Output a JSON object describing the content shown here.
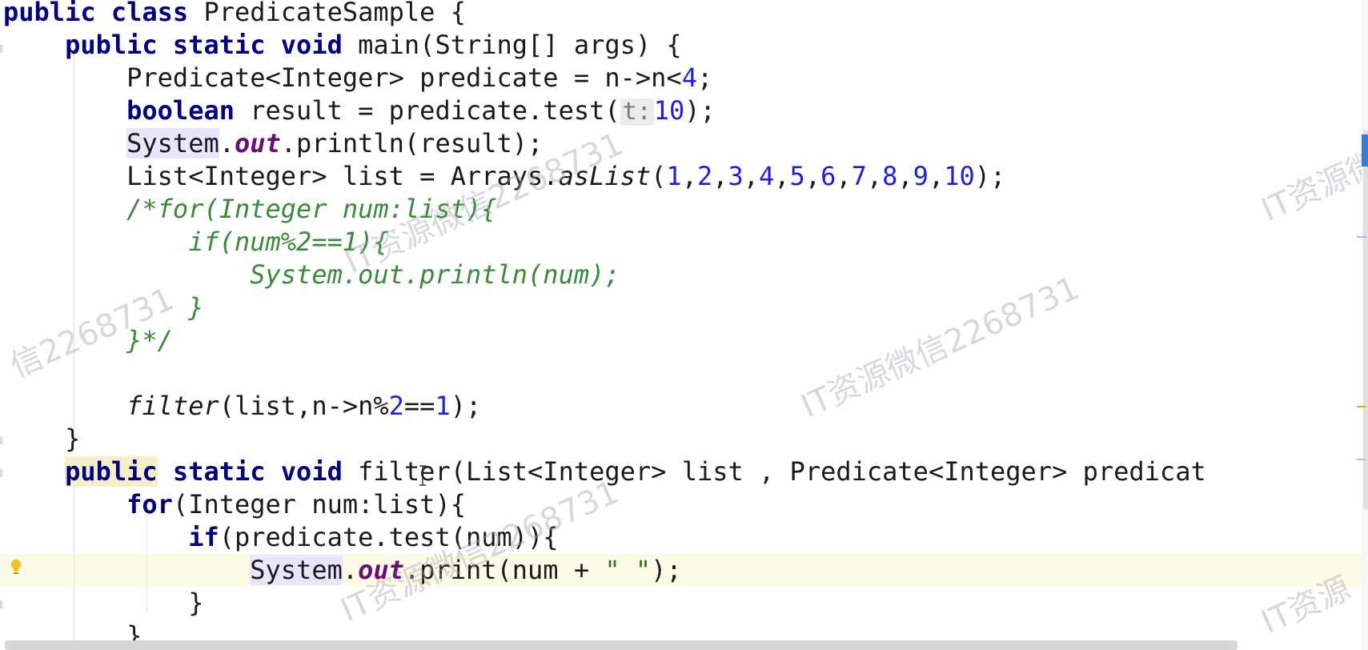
{
  "editor": {
    "file_class": "PredicateSample",
    "lines": {
      "l01": [
        "public",
        "class",
        "PredicateSample {"
      ],
      "l02": [
        "public",
        "static",
        "void",
        "main(String[] args) {"
      ],
      "l03": [
        "Predicate<Integer> predicate = n->n<",
        "4",
        ";"
      ],
      "l04": [
        "boolean",
        " result = predicate.test(",
        "t:",
        "10",
        ");"
      ],
      "l05": [
        "System",
        ".",
        "out",
        ".println(result);"
      ],
      "l06": [
        "List<Integer> list = Arrays.",
        "asList",
        "(",
        "1",
        ",",
        "2",
        ",",
        "3",
        ",",
        "4",
        ",",
        "5",
        ",",
        "6",
        ",",
        "7",
        ",",
        "8",
        ",",
        "9",
        ",",
        "10",
        ");"
      ],
      "l07": "/*for(Integer num:list){",
      "l08": "if(num%2==1){",
      "l09": "System.out.println(num);",
      "l10": "}",
      "l11": "}*/",
      "l12": [
        "filter",
        "(list,n->n%",
        "2",
        "==",
        "1",
        ");"
      ],
      "l13": "}",
      "l14": [
        "public",
        "static",
        "void",
        "filter(List<Integer> list , Predicate<Integer> predicat"
      ],
      "l15": [
        "for",
        "(Integer num:list){"
      ],
      "l16": [
        "if",
        "(predicate.test(num)){"
      ],
      "l17": [
        "System",
        ".",
        "out",
        ".print(num + ",
        "\" \"",
        ");"
      ],
      "l18": "}",
      "l19": "}"
    }
  },
  "watermark": {
    "w1": "IT资源微信2268731",
    "w2": "IT资源微信2268731",
    "w3": "信2268731",
    "w4": "IT资源微",
    "w5": "IT资源微信2268731",
    "w6": "IT资源"
  },
  "colors": {
    "keyword": "#000080",
    "number": "#1f1fd8",
    "comment": "#3a8a3a",
    "static_field": "#660e7a",
    "caret_row": "#fdfbe6",
    "usage_highlight": "#e8e6fb"
  },
  "icons": {
    "gutter": "lightbulb-icon"
  }
}
